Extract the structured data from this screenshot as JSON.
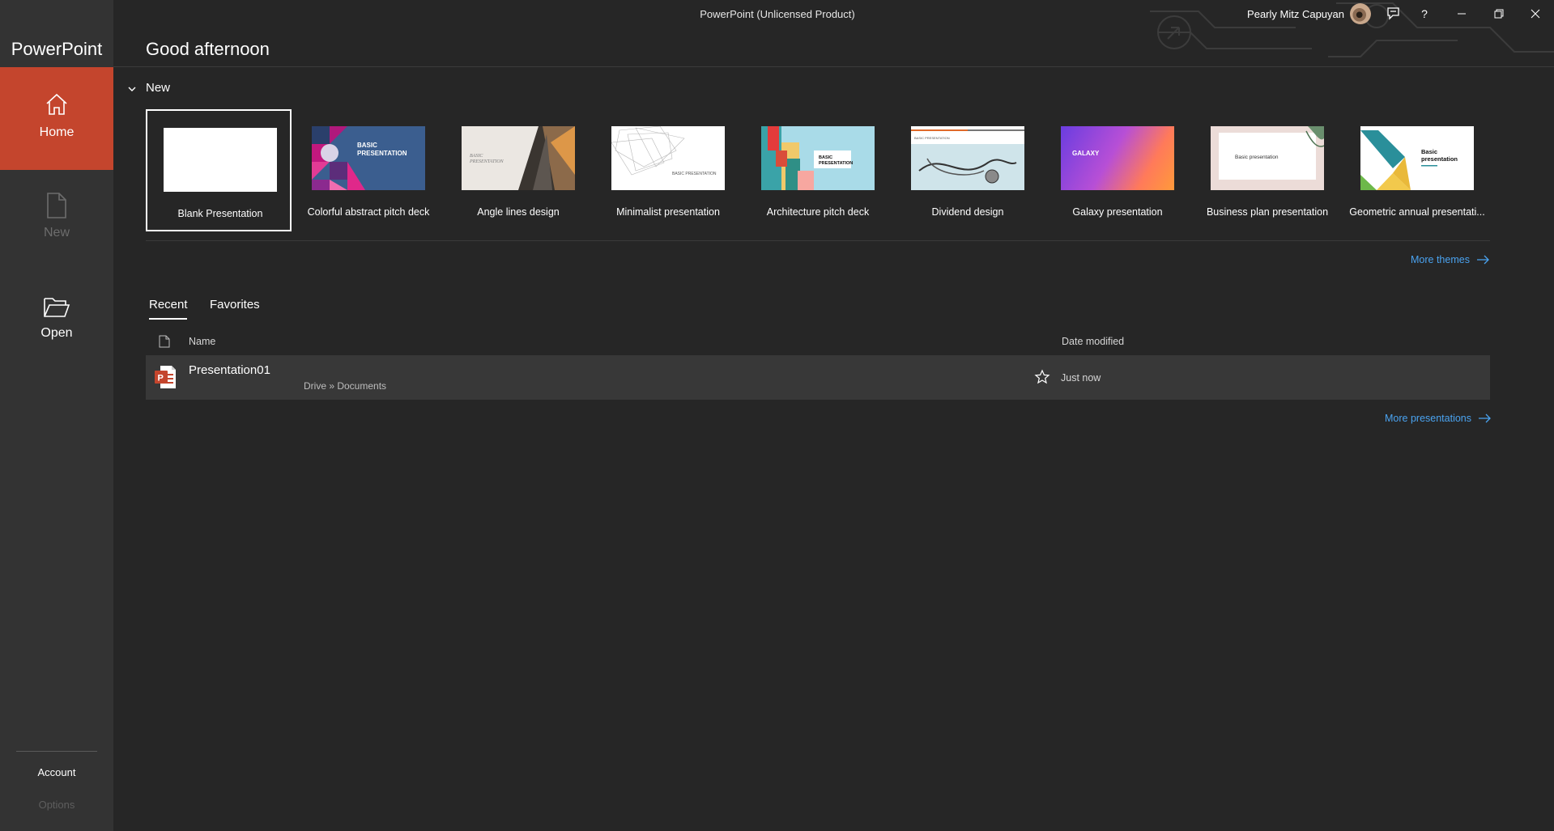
{
  "window": {
    "title": "PowerPoint (Unlicensed Product)",
    "user_name": "Pearly Mitz Capuyan"
  },
  "sidebar": {
    "app_name": "PowerPoint",
    "items": [
      {
        "label": "Home",
        "icon": "home-icon",
        "active": true
      },
      {
        "label": "New",
        "icon": "new-document-icon",
        "disabled": true
      },
      {
        "label": "Open",
        "icon": "folder-open-icon"
      }
    ],
    "account": "Account",
    "options": "Options"
  },
  "header": {
    "greeting": "Good afternoon"
  },
  "new_section": {
    "label": "New",
    "templates": [
      {
        "label": "Blank Presentation"
      },
      {
        "label": "Colorful abstract pitch deck",
        "thumb_text": "BASIC\nPRESENTATION"
      },
      {
        "label": "Angle lines design",
        "thumb_text": "BASIC PRESENTATION"
      },
      {
        "label": "Minimalist presentation",
        "thumb_text": "BASIC PRESENTATION"
      },
      {
        "label": "Architecture pitch deck",
        "thumb_text": "BASIC PRESENTATION"
      },
      {
        "label": "Dividend design",
        "thumb_text": "BASIC PRESENTATION"
      },
      {
        "label": "Galaxy presentation",
        "thumb_text": "GALAXY"
      },
      {
        "label": "Business plan presentation",
        "thumb_text": "Basic presentation"
      },
      {
        "label": "Geometric annual presentati...",
        "thumb_text": "Basic presentation"
      }
    ],
    "more_themes": "More themes"
  },
  "files": {
    "tabs": [
      "Recent",
      "Favorites"
    ],
    "active_tab": "Recent",
    "columns": {
      "name": "Name",
      "date": "Date modified"
    },
    "rows": [
      {
        "name": "Presentation01",
        "path": "Drive » Documents",
        "date": "Just now"
      }
    ],
    "more_presentations": "More presentations"
  },
  "colors": {
    "accent": "#c4452d",
    "background": "#262626",
    "sidebar": "#333333",
    "link": "#4aa3f0"
  }
}
